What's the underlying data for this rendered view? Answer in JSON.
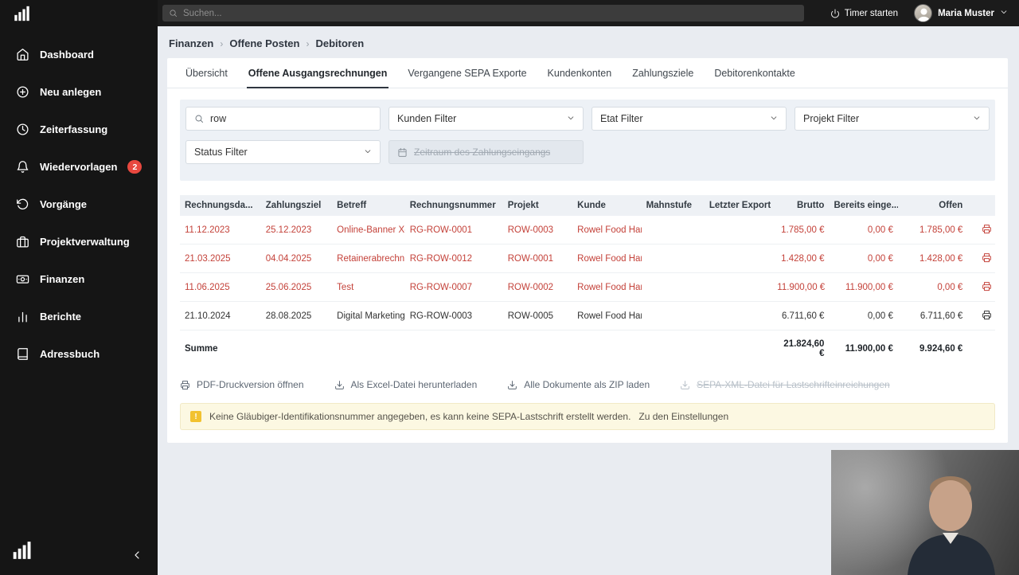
{
  "colors": {
    "sidebar_bg": "#151515",
    "accent_overdue_red": "#c4423a",
    "badge_red": "#e8483f",
    "warning_bg": "#fcf8e2",
    "warning_icon": "#f2c230",
    "page_bg": "#e9ecf1"
  },
  "topbar": {
    "search_placeholder": "Suchen...",
    "timer_label": "Timer starten",
    "user_name": "Maria Muster"
  },
  "sidebar": {
    "items": [
      {
        "label": "Dashboard",
        "icon": "home-icon"
      },
      {
        "label": "Neu anlegen",
        "icon": "plus-circle-icon"
      },
      {
        "label": "Zeiterfassung",
        "icon": "clock-icon"
      },
      {
        "label": "Wiedervorlagen",
        "icon": "bell-icon",
        "badge": "2"
      },
      {
        "label": "Vorgänge",
        "icon": "history-icon"
      },
      {
        "label": "Projektverwaltung",
        "icon": "briefcase-icon"
      },
      {
        "label": "Finanzen",
        "icon": "banknote-icon"
      },
      {
        "label": "Berichte",
        "icon": "bar-chart-icon"
      },
      {
        "label": "Adressbuch",
        "icon": "address-book-icon"
      }
    ]
  },
  "breadcrumb": {
    "separator": "›",
    "items": [
      "Finanzen",
      "Offene Posten",
      "Debitoren"
    ]
  },
  "tabs": [
    "Übersicht",
    "Offene Ausgangsrechnungen",
    "Vergangene SEPA Exporte",
    "Kundenkonten",
    "Zahlungsziele",
    "Debitorenkontakte"
  ],
  "filters": {
    "search_value": "row",
    "kunden_label": "Kunden Filter",
    "etat_label": "Etat Filter",
    "projekt_label": "Projekt Filter",
    "status_label": "Status Filter",
    "payment_period_label": "Zeitraum des Zahlungseingangs"
  },
  "table": {
    "headers": [
      "Rechnungsda...",
      "Zahlungsziel",
      "Betreff",
      "Rechnungsnummer",
      "Projekt",
      "Kunde",
      "Mahnstufe",
      "Letzter Export",
      "Brutto",
      "Bereits einge...",
      "Offen"
    ],
    "rows": [
      {
        "date": "11.12.2023",
        "due": "25.12.2023",
        "subject": "Online-Banner X-S",
        "number": "RG-ROW-0001",
        "project": "ROW-0003",
        "customer": "Rowel Food Handel",
        "mahnstufe": "",
        "last_export": "",
        "brutto": "1.785,00 €",
        "received": "0,00 €",
        "open": "1.785,00 €"
      },
      {
        "date": "21.03.2025",
        "due": "04.04.2025",
        "subject": "Retainerabrechnung",
        "number": "RG-ROW-0012",
        "project": "ROW-0001",
        "customer": "Rowel Food Handel",
        "mahnstufe": "",
        "last_export": "",
        "brutto": "1.428,00 €",
        "received": "0,00 €",
        "open": "1.428,00 €"
      },
      {
        "date": "11.06.2025",
        "due": "25.06.2025",
        "subject": "Test",
        "number": "RG-ROW-0007",
        "project": "ROW-0002",
        "customer": "Rowel Food Handel",
        "mahnstufe": "",
        "last_export": "",
        "brutto": "11.900,00 €",
        "received": "11.900,00 €",
        "open": "0,00 €"
      },
      {
        "date": "21.10.2024",
        "due": "28.08.2025",
        "subject": "Digital Marketing",
        "number": "RG-ROW-0003",
        "project": "ROW-0005",
        "customer": "Rowel Food Handel",
        "mahnstufe": "",
        "last_export": "",
        "brutto": "6.711,60 €",
        "received": "0,00 €",
        "open": "6.711,60 €"
      }
    ],
    "sum": {
      "label": "Summe",
      "brutto": "21.824,60 €",
      "received": "11.900,00 €",
      "open": "9.924,60 €"
    }
  },
  "actions": [
    {
      "label": "PDF-Druckversion öffnen"
    },
    {
      "label": "Als Excel-Datei herunterladen"
    },
    {
      "label": "Alle Dokumente als ZIP laden"
    },
    {
      "label": "SEPA-XML-Datei für Lastschrifteinreichungen",
      "disabled": true
    }
  ],
  "warning": {
    "text": "Keine Gläubiger-Identifikationsnummer angegeben, es kann keine SEPA-Lastschrift erstellt werden.",
    "link_label": "Zu den Einstellungen"
  }
}
